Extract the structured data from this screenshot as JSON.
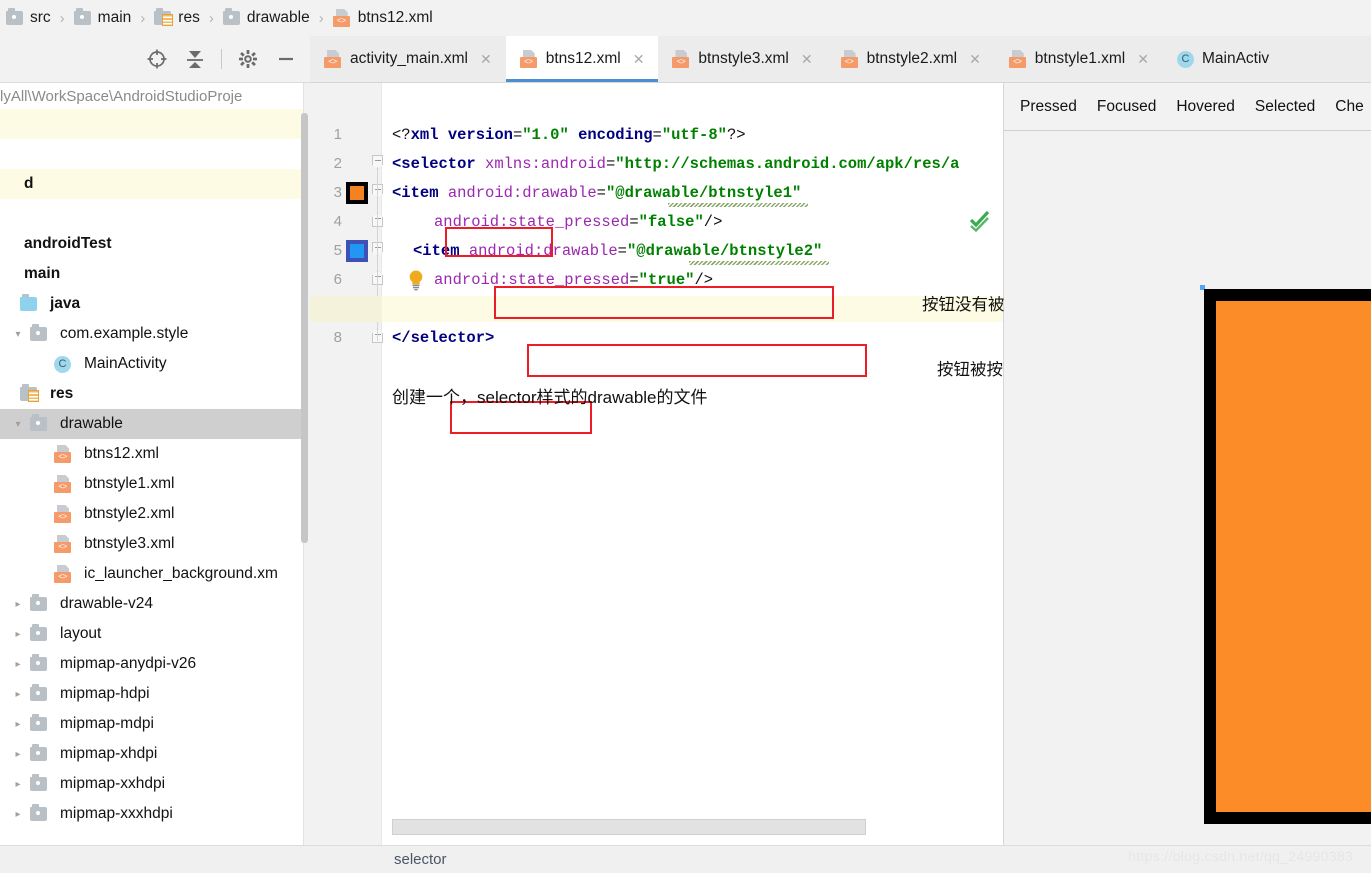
{
  "breadcrumb": {
    "items": [
      {
        "label": "src",
        "icon": "folder-icon"
      },
      {
        "label": "main",
        "icon": "folder-icon"
      },
      {
        "label": "res",
        "icon": "res-folder-icon"
      },
      {
        "label": "drawable",
        "icon": "folder-icon"
      },
      {
        "label": "btns12.xml",
        "icon": "xml-file-icon"
      }
    ],
    "separator": "›"
  },
  "panel_toolbar": {
    "icons": [
      {
        "name": "locate-target-icon",
        "title": "Select Opened File"
      },
      {
        "name": "collapse-all-icon",
        "title": "Collapse All"
      },
      {
        "name": "settings-gear-icon",
        "title": "Settings"
      },
      {
        "name": "minimize-icon",
        "title": "Hide"
      }
    ]
  },
  "project_tree": {
    "path_label": "lyAll\\WorkSpace\\AndroidStudioProje",
    "rows": [
      {
        "label": "",
        "indent": 0,
        "arrow": "none",
        "icon": "none",
        "state": "highlight"
      },
      {
        "label": "",
        "indent": 0,
        "arrow": "none",
        "icon": "none",
        "state": "normal"
      },
      {
        "label": "d",
        "indent": 0,
        "arrow": "none",
        "icon": "none",
        "state": "highlight"
      },
      {
        "label": "",
        "indent": 0,
        "arrow": "none",
        "icon": "none",
        "state": "normal"
      },
      {
        "label": "androidTest",
        "indent": 0,
        "arrow": "none",
        "icon": "none",
        "state": "normal"
      },
      {
        "label": "main",
        "indent": 0,
        "arrow": "none",
        "icon": "none",
        "state": "normal"
      },
      {
        "label": "java",
        "indent": 0,
        "arrow": "none",
        "icon": "java-folder-icon",
        "state": "normal"
      },
      {
        "label": "com.example.style",
        "indent": 1,
        "arrow": "open",
        "icon": "folder-icon",
        "state": "normal"
      },
      {
        "label": "MainActivity",
        "indent": 2,
        "arrow": "none",
        "icon": "class-icon",
        "state": "normal"
      },
      {
        "label": "res",
        "indent": 0,
        "arrow": "none",
        "icon": "res-folder-icon",
        "state": "normal"
      },
      {
        "label": "drawable",
        "indent": 1,
        "arrow": "open",
        "icon": "folder-icon",
        "state": "selected"
      },
      {
        "label": "btns12.xml",
        "indent": 2,
        "arrow": "none",
        "icon": "xml-file-icon",
        "state": "normal"
      },
      {
        "label": "btnstyle1.xml",
        "indent": 2,
        "arrow": "none",
        "icon": "xml-file-icon",
        "state": "normal"
      },
      {
        "label": "btnstyle2.xml",
        "indent": 2,
        "arrow": "none",
        "icon": "xml-file-icon",
        "state": "normal"
      },
      {
        "label": "btnstyle3.xml",
        "indent": 2,
        "arrow": "none",
        "icon": "xml-file-icon",
        "state": "normal"
      },
      {
        "label": "ic_launcher_background.xm",
        "indent": 2,
        "arrow": "none",
        "icon": "xml-file-icon",
        "state": "normal"
      },
      {
        "label": "drawable-v24",
        "indent": 1,
        "arrow": "closed",
        "icon": "folder-icon",
        "state": "normal"
      },
      {
        "label": "layout",
        "indent": 1,
        "arrow": "closed",
        "icon": "folder-icon",
        "state": "normal"
      },
      {
        "label": "mipmap-anydpi-v26",
        "indent": 1,
        "arrow": "closed",
        "icon": "folder-icon",
        "state": "normal"
      },
      {
        "label": "mipmap-hdpi",
        "indent": 1,
        "arrow": "closed",
        "icon": "folder-icon",
        "state": "normal"
      },
      {
        "label": "mipmap-mdpi",
        "indent": 1,
        "arrow": "closed",
        "icon": "folder-icon",
        "state": "normal"
      },
      {
        "label": "mipmap-xhdpi",
        "indent": 1,
        "arrow": "closed",
        "icon": "folder-icon",
        "state": "normal"
      },
      {
        "label": "mipmap-xxhdpi",
        "indent": 1,
        "arrow": "closed",
        "icon": "folder-icon",
        "state": "normal"
      },
      {
        "label": "mipmap-xxxhdpi",
        "indent": 1,
        "arrow": "closed",
        "icon": "folder-icon",
        "state": "normal"
      }
    ]
  },
  "editor_tabs": [
    {
      "label": "activity_main.xml",
      "icon": "xml-file-icon",
      "active": false,
      "closable": true
    },
    {
      "label": "btns12.xml",
      "icon": "xml-file-icon",
      "active": true,
      "closable": true
    },
    {
      "label": "btnstyle3.xml",
      "icon": "xml-file-icon",
      "active": false,
      "closable": true
    },
    {
      "label": "btnstyle2.xml",
      "icon": "xml-file-icon",
      "active": false,
      "closable": true
    },
    {
      "label": "btnstyle1.xml",
      "icon": "xml-file-icon",
      "active": false,
      "closable": true
    },
    {
      "label": "MainActiv",
      "icon": "class-icon",
      "active": false,
      "closable": false
    }
  ],
  "code": {
    "line_numbers": [
      "1",
      "2",
      "3",
      "4",
      "5",
      "6",
      "7",
      "8"
    ],
    "lines": [
      {
        "n": "1",
        "indent": 0,
        "tokens": [
          {
            "t": "<?",
            "c": "punct"
          },
          {
            "t": "xml version",
            "c": "tag"
          },
          {
            "t": "=",
            "c": "punct"
          },
          {
            "t": "\"1.0\"",
            "c": "val"
          },
          {
            "t": " ",
            "c": "punct"
          },
          {
            "t": "encoding",
            "c": "tag"
          },
          {
            "t": "=",
            "c": "punct"
          },
          {
            "t": "\"utf-8\"",
            "c": "val"
          },
          {
            "t": "?>",
            "c": "punct"
          }
        ]
      },
      {
        "n": "2",
        "indent": 0,
        "tokens": [
          {
            "t": "<selector",
            "c": "tag"
          },
          {
            "t": " ",
            "c": "punct"
          },
          {
            "t": "xmlns:android",
            "c": "attr"
          },
          {
            "t": "=",
            "c": "punct"
          },
          {
            "t": "\"http://schemas.android.com/apk/res/a",
            "c": "val"
          }
        ]
      },
      {
        "n": "3",
        "indent": 0,
        "tokens": [
          {
            "t": "<item",
            "c": "tag"
          },
          {
            "t": " ",
            "c": "punct"
          },
          {
            "t": "android:drawable",
            "c": "attr"
          },
          {
            "t": "=",
            "c": "punct"
          },
          {
            "t": "\"@drawable/btnstyle1\"",
            "c": "val"
          }
        ]
      },
      {
        "n": "4",
        "indent": 2,
        "tokens": [
          {
            "t": "android:state_pressed",
            "c": "attr"
          },
          {
            "t": "=",
            "c": "punct"
          },
          {
            "t": "\"false\"",
            "c": "val"
          },
          {
            "t": "/>",
            "c": "punct"
          }
        ]
      },
      {
        "n": "5",
        "indent": 1,
        "tokens": [
          {
            "t": "<item",
            "c": "tag"
          },
          {
            "t": " ",
            "c": "punct"
          },
          {
            "t": "android:drawable",
            "c": "attr"
          },
          {
            "t": "=",
            "c": "punct"
          },
          {
            "t": "\"@drawable/btnstyle2\"",
            "c": "val"
          }
        ]
      },
      {
        "n": "6",
        "indent": 2,
        "tokens": [
          {
            "t": "android:state_pressed",
            "c": "attr"
          },
          {
            "t": "=",
            "c": "punct"
          },
          {
            "t": "\"true\"",
            "c": "val"
          },
          {
            "t": "/>",
            "c": "punct"
          }
        ]
      },
      {
        "n": "7",
        "indent": 0,
        "tokens": []
      },
      {
        "n": "8",
        "indent": 0,
        "tokens": [
          {
            "t": "</selector>",
            "c": "tag"
          }
        ]
      }
    ],
    "gutter_swatches": [
      {
        "line": 3,
        "color": "#F58220",
        "border": "#000000"
      },
      {
        "line": 5,
        "color": "#2196F3",
        "border": "#3F51B5"
      }
    ],
    "gutter_bulb_line": 6,
    "inspection_status": "no-problems-check",
    "annotations": [
      {
        "text": "按钮没有被按下时",
        "line": 4
      },
      {
        "text": "按钮被按下时",
        "line": 6
      }
    ],
    "description": "创建一个，selector样式的drawable的文件",
    "highlight_lines": [
      7
    ]
  },
  "preview": {
    "states": [
      "Pressed",
      "Focused",
      "Hovered",
      "Selected",
      "Che"
    ],
    "button": {
      "fill": "#FB8C27",
      "border": "#000000"
    }
  },
  "bottom": {
    "breadcrumb": "selector",
    "watermark": "https://blog.csdn.net/qq_24990383"
  },
  "colors": {
    "accent": "#4A8FD0",
    "tag": "#000080",
    "attr": "#9C27B0",
    "value": "#008000",
    "annotation_box": "#EE1C25",
    "orange": "#F58220"
  }
}
